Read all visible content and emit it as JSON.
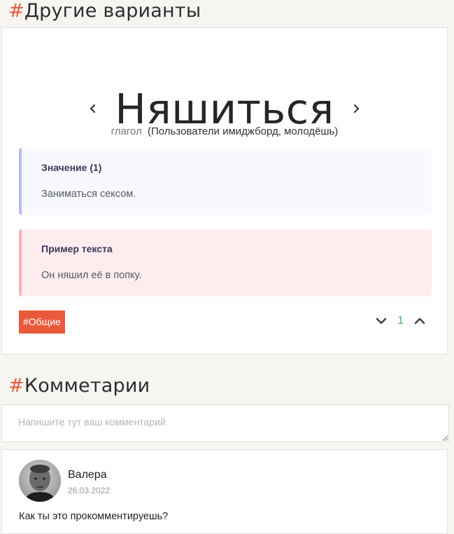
{
  "other_variants_section": {
    "hash": "#",
    "title": "Другие варианты"
  },
  "word_card": {
    "word": "Няшиться",
    "part_of_speech": "глагол",
    "authors": "(Пользователи имиджборд, молодёшь)",
    "meaning": {
      "heading": "Значение (1)",
      "text": "Заниматься сексом."
    },
    "example": {
      "heading": "Пример текста",
      "text": "Он няшил её в попку."
    },
    "tag": "#Общие",
    "vote_count": "1",
    "icons": {
      "prev": "chevron-left-icon",
      "next": "chevron-right-icon",
      "vote_down": "chevron-down-icon",
      "vote_up": "chevron-up-icon"
    }
  },
  "comments_section": {
    "hash": "#",
    "title": "Комметарии",
    "input_placeholder": "Напишите тут ваш комментарий"
  },
  "comments": [
    {
      "author": "Валера",
      "date": "26.03.2022",
      "text": "Как ты это прокомментируешь?"
    }
  ],
  "colors": {
    "accent": "#e95a3c",
    "vote_count": "#4caf50",
    "meaning_bg": "#f8f8ff",
    "meaning_border": "#b9b9f5",
    "example_bg": "#ffecee",
    "example_border": "#f5b3bb"
  }
}
